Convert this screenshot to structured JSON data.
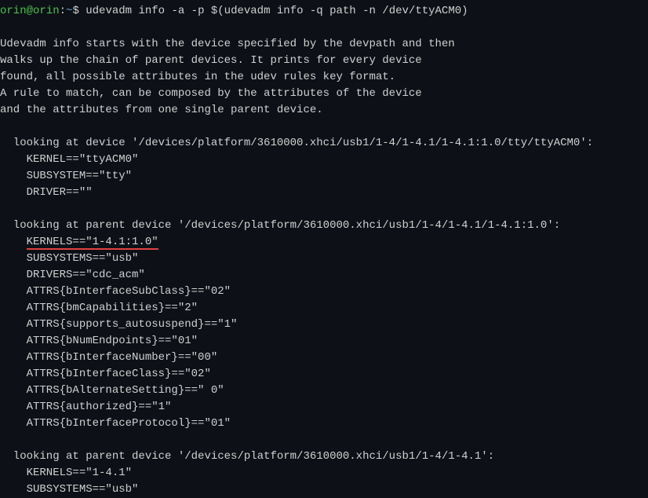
{
  "prompt": {
    "user": "orin",
    "at": "@",
    "host": "orin",
    "colon": ":",
    "path": "~",
    "dollar": "$ "
  },
  "command": "udevadm info -a -p $(udevadm info -q path -n /dev/ttyACM0)",
  "intro": [
    "Udevadm info starts with the device specified by the devpath and then",
    "walks up the chain of parent devices. It prints for every device",
    "found, all possible attributes in the udev rules key format.",
    "A rule to match, can be composed by the attributes of the device",
    "and the attributes from one single parent device."
  ],
  "device": {
    "header": "  looking at device '/devices/platform/3610000.xhci/usb1/1-4/1-4.1/1-4.1:1.0/tty/ttyACM0':",
    "kernel": "    KERNEL==\"ttyACM0\"",
    "subsystem": "    SUBSYSTEM==\"tty\"",
    "driver": "    DRIVER==\"\""
  },
  "parent1": {
    "header": "  looking at parent device '/devices/platform/3610000.xhci/usb1/1-4/1-4.1/1-4.1:1.0':",
    "kernels": "KERNELS==\"1-4.1:1.0\"",
    "subsystems": "    SUBSYSTEMS==\"usb\"",
    "drivers": "    DRIVERS==\"cdc_acm\"",
    "attrs": [
      "    ATTRS{bInterfaceSubClass}==\"02\"",
      "    ATTRS{bmCapabilities}==\"2\"",
      "    ATTRS{supports_autosuspend}==\"1\"",
      "    ATTRS{bNumEndpoints}==\"01\"",
      "    ATTRS{bInterfaceNumber}==\"00\"",
      "    ATTRS{bInterfaceClass}==\"02\"",
      "    ATTRS{bAlternateSetting}==\" 0\"",
      "    ATTRS{authorized}==\"1\"",
      "    ATTRS{bInterfaceProtocol}==\"01\""
    ]
  },
  "parent2": {
    "header": "  looking at parent device '/devices/platform/3610000.xhci/usb1/1-4/1-4.1':",
    "kernels": "    KERNELS==\"1-4.1\"",
    "subsystems": "    SUBSYSTEMS==\"usb\""
  }
}
